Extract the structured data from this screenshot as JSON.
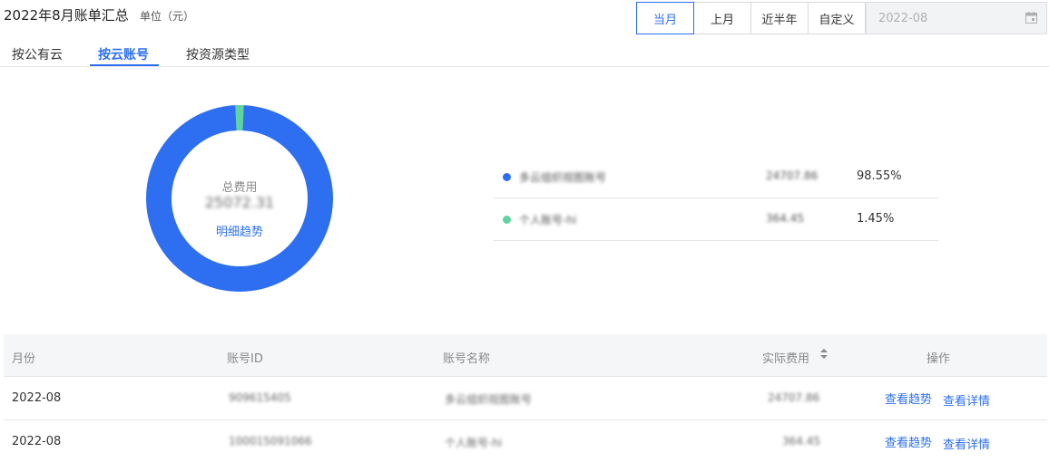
{
  "header": {
    "title": "2022年8月账单汇总",
    "unit": "单位（元）"
  },
  "range_buttons": [
    {
      "label": "当月",
      "active": true
    },
    {
      "label": "上月",
      "active": false
    },
    {
      "label": "近半年",
      "active": false
    },
    {
      "label": "自定义",
      "active": false
    }
  ],
  "date_picker": {
    "value": "2022-08"
  },
  "tabs": [
    {
      "label": "按公有云",
      "active": false
    },
    {
      "label": "按云账号",
      "active": true
    },
    {
      "label": "按资源类型",
      "active": false
    }
  ],
  "summary": {
    "title": "总费用",
    "total": "25072.31",
    "link": "明细趋势"
  },
  "chart_data": {
    "type": "pie",
    "labels": [
      "多云组织视图账号",
      "个人账号-hi"
    ],
    "values": [
      24707.86,
      364.45
    ],
    "percentages": [
      98.55,
      1.45
    ],
    "colors": [
      "#2d6ff0",
      "#5fd3a0"
    ]
  },
  "legend": [
    {
      "name": "多云组织视图账号",
      "amount": "24707.86",
      "percent": "98.55%",
      "color": "#2d6ff0"
    },
    {
      "name": "个人账号-hi",
      "amount": "364.45",
      "percent": "1.45%",
      "color": "#5fd3a0"
    }
  ],
  "table": {
    "headers": {
      "month": "月份",
      "account_id": "账号ID",
      "account_name": "账号名称",
      "cost": "实际费用",
      "ops": "操作"
    },
    "rows": [
      {
        "month": "2022-08",
        "account_id": "909615405",
        "account_name": "多云组织视图账号",
        "cost": "24707.86",
        "trend": "查看趋势",
        "detail": "查看详情"
      },
      {
        "month": "2022-08",
        "account_id": "100015091066",
        "account_name": "个人账号-hi",
        "cost": "364.45",
        "trend": "查看趋势",
        "detail": "查看详情"
      }
    ]
  }
}
